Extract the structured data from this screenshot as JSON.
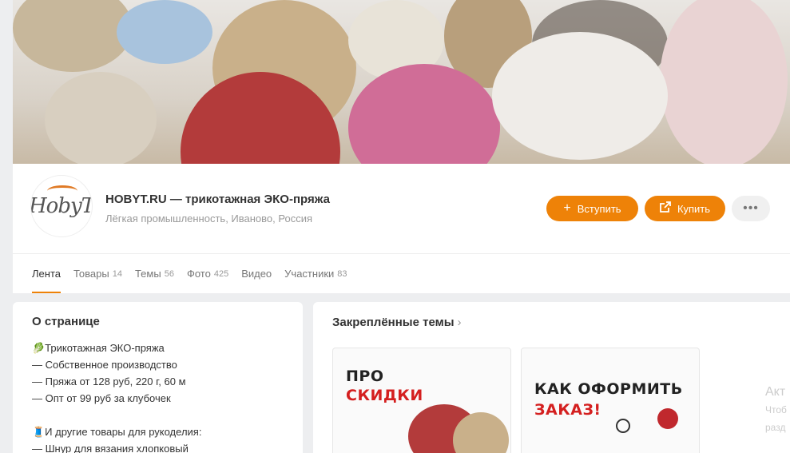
{
  "group": {
    "title": "HOBYT.RU — трикотажная ЭКО-пряжа",
    "subtitle": "Лёгкая промышленность, Иваново, Россия",
    "logo_text": "HobyT"
  },
  "actions": {
    "join_label": "Вступить",
    "buy_label": "Купить",
    "more_label": "•••"
  },
  "tabs": [
    {
      "label": "Лента",
      "count": ""
    },
    {
      "label": "Товары",
      "count": "14"
    },
    {
      "label": "Темы",
      "count": "56"
    },
    {
      "label": "Фото",
      "count": "425"
    },
    {
      "label": "Видео",
      "count": ""
    },
    {
      "label": "Участники",
      "count": "83"
    }
  ],
  "about": {
    "title": "О странице",
    "lines": [
      "🥬Трикотажная ЭКО-пряжа",
      "— Собственное производство",
      "— Пряжа от 128 руб, 220 г, 60 м",
      "— Опт от 99 руб за клубочек",
      "",
      "🧵И другие товары для рукоделия:",
      "— Шнур для вязания хлопковый"
    ]
  },
  "pinned": {
    "title": "Закреплённые темы",
    "cards": [
      {
        "line1": "ПРО",
        "line2": "СКИДКИ"
      },
      {
        "line1": "КАК ОФОРМИТЬ",
        "line2": "ЗАКАЗ!"
      }
    ]
  },
  "side_ghost": {
    "title": "Акт",
    "line1": "Чтоб",
    "line2": "разд"
  },
  "colors": {
    "accent": "#ee8208",
    "background": "#edeef0",
    "card_red": "#d41f1f"
  }
}
